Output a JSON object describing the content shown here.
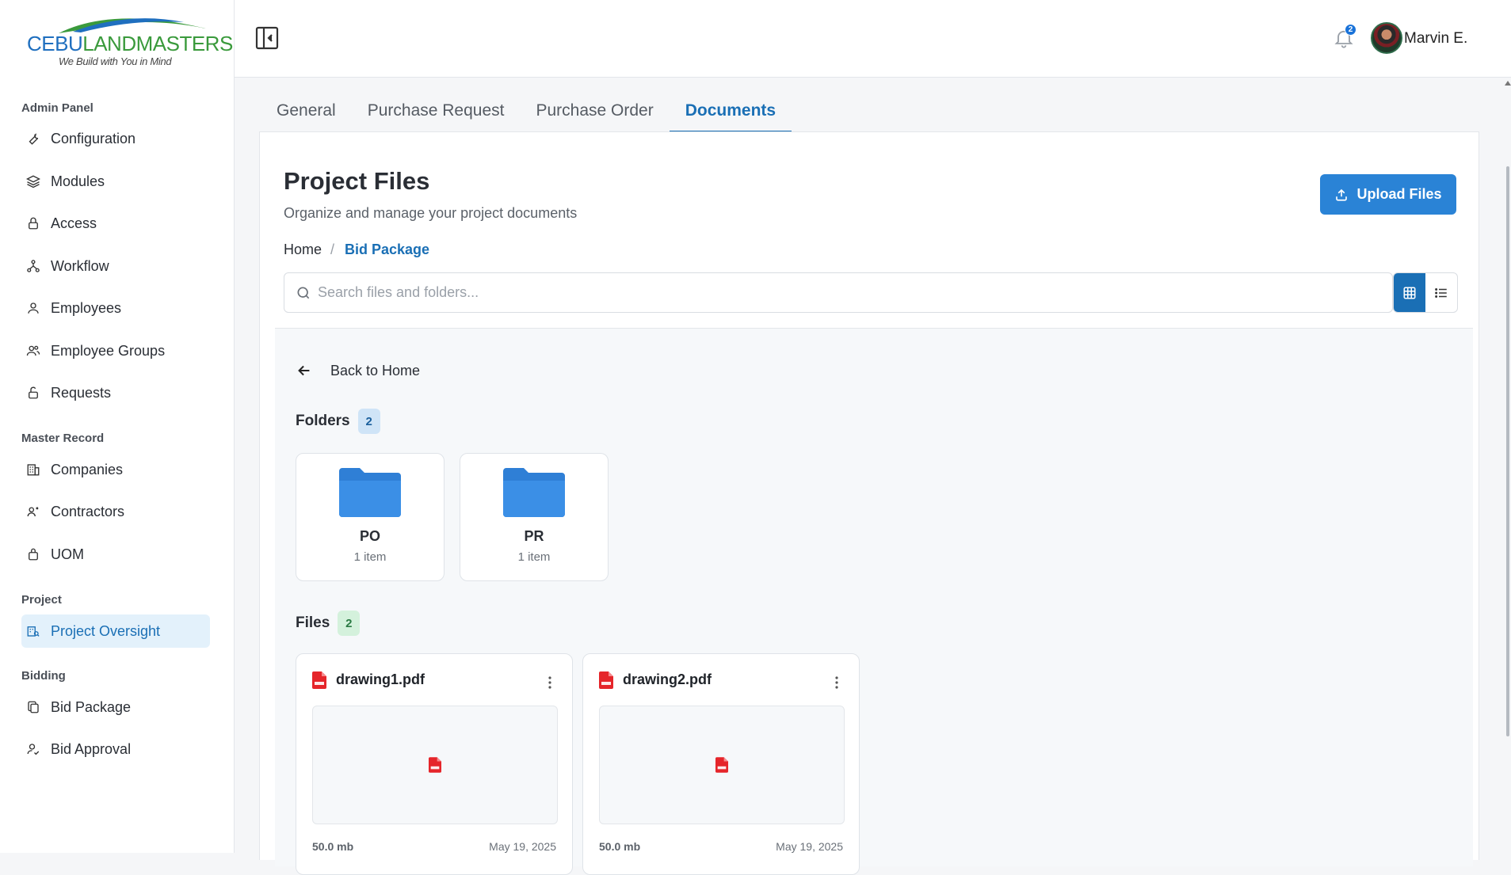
{
  "brand": {
    "name_part1": "CEBU",
    "name_part2": "LANDMASTERS",
    "tagline": "We Build with You in Mind",
    "colors": {
      "blue": "#1f6fbf",
      "green": "#3a9a3c"
    }
  },
  "sidebar": {
    "sections": [
      {
        "title": "Admin Panel",
        "items": [
          {
            "label": "Configuration",
            "icon": "wrench-icon"
          },
          {
            "label": "Modules",
            "icon": "layers-icon"
          },
          {
            "label": "Access",
            "icon": "lock-icon"
          },
          {
            "label": "Workflow",
            "icon": "workflow-icon"
          },
          {
            "label": "Employees",
            "icon": "user-icon"
          },
          {
            "label": "Employee Groups",
            "icon": "users-icon"
          },
          {
            "label": "Requests",
            "icon": "unlock-icon"
          }
        ]
      },
      {
        "title": "Master Record",
        "items": [
          {
            "label": "Companies",
            "icon": "building-icon"
          },
          {
            "label": "Contractors",
            "icon": "contractor-icon"
          },
          {
            "label": "UOM",
            "icon": "bag-icon"
          }
        ]
      },
      {
        "title": "Project",
        "items": [
          {
            "label": "Project Oversight",
            "icon": "project-icon",
            "active": true
          }
        ]
      },
      {
        "title": "Bidding",
        "items": [
          {
            "label": "Bid Package",
            "icon": "copy-icon"
          },
          {
            "label": "Bid Approval",
            "icon": "approval-icon"
          }
        ]
      }
    ]
  },
  "header": {
    "notification_count": "2",
    "user_name": "Marvin E."
  },
  "tabs": [
    {
      "label": "General"
    },
    {
      "label": "Purchase Request"
    },
    {
      "label": "Purchase Order"
    },
    {
      "label": "Documents",
      "active": true
    }
  ],
  "page": {
    "title": "Project Files",
    "subtitle": "Organize and manage your project documents",
    "upload_label": "Upload Files",
    "breadcrumb": {
      "home": "Home",
      "separator": "/",
      "current": "Bid Package"
    },
    "search_placeholder": "Search files and folders...",
    "view_mode": "grid",
    "back_label": "Back to Home",
    "folders_title": "Folders",
    "folders_count": "2",
    "folders": [
      {
        "name": "PO",
        "count": "1 item"
      },
      {
        "name": "PR",
        "count": "1 item"
      }
    ],
    "files_title": "Files",
    "files_count": "2",
    "files": [
      {
        "name": "drawing1.pdf",
        "size": "50.0 mb",
        "date": "May 19, 2025",
        "icon": "pdf-icon"
      },
      {
        "name": "drawing2.pdf",
        "size": "50.0 mb",
        "date": "May 19, 2025",
        "icon": "pdf-icon"
      }
    ],
    "accent_color": "#1a6fb5"
  }
}
